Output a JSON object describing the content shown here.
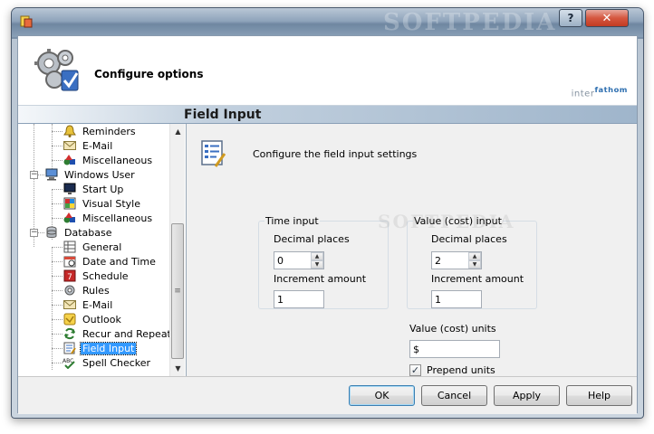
{
  "window": {
    "title_watermark": "SOFTPEDIA",
    "help_glyph": "?",
    "close_glyph": "✕"
  },
  "header": {
    "title": "Configure options",
    "brand_inter": "inter",
    "brand_fathom": "fathom"
  },
  "section": {
    "title": "Field Input"
  },
  "tree": {
    "items": [
      {
        "label": "Reminders",
        "icon": "bell-icon"
      },
      {
        "label": "E-Mail",
        "icon": "envelope-icon"
      },
      {
        "label": "Miscellaneous",
        "icon": "shapes-icon"
      },
      {
        "label": "Windows User",
        "icon": "computer-icon"
      },
      {
        "label": "Start Up",
        "icon": "monitor-icon"
      },
      {
        "label": "Visual Style",
        "icon": "palette-icon"
      },
      {
        "label": "Miscellaneous",
        "icon": "shapes-icon"
      },
      {
        "label": "Database",
        "icon": "database-icon"
      },
      {
        "label": "General",
        "icon": "table-icon"
      },
      {
        "label": "Date and Time",
        "icon": "calendar-icon"
      },
      {
        "label": "Schedule",
        "icon": "schedule-icon"
      },
      {
        "label": "Rules",
        "icon": "rules-icon"
      },
      {
        "label": "E-Mail",
        "icon": "envelope-icon"
      },
      {
        "label": "Outlook",
        "icon": "outlook-icon"
      },
      {
        "label": "Recur and Repeat",
        "icon": "recur-icon"
      },
      {
        "label": "Field Input",
        "icon": "form-icon",
        "selected": true
      },
      {
        "label": "Spell Checker",
        "icon": "spellcheck-icon"
      }
    ],
    "scroll_up": "▲",
    "scroll_down": "▼",
    "thumb_grip": "≡"
  },
  "content": {
    "description": "Configure the field input settings",
    "time_input": {
      "group_label": "Time input",
      "decimal_label": "Decimal places",
      "decimal_value": "0",
      "increment_label": "Increment amount",
      "increment_value": "1"
    },
    "value_input": {
      "group_label": "Value (cost) input",
      "decimal_label": "Decimal places",
      "decimal_value": "2",
      "increment_label": "Increment amount",
      "increment_value": "1"
    },
    "units": {
      "label": "Value (cost) units",
      "value": "$",
      "prepend_label": "Prepend units",
      "prepend_checked": true
    },
    "watermark": "SOFTPEDIA"
  },
  "footer": {
    "ok": "OK",
    "cancel": "Cancel",
    "apply": "Apply",
    "help": "Help"
  }
}
